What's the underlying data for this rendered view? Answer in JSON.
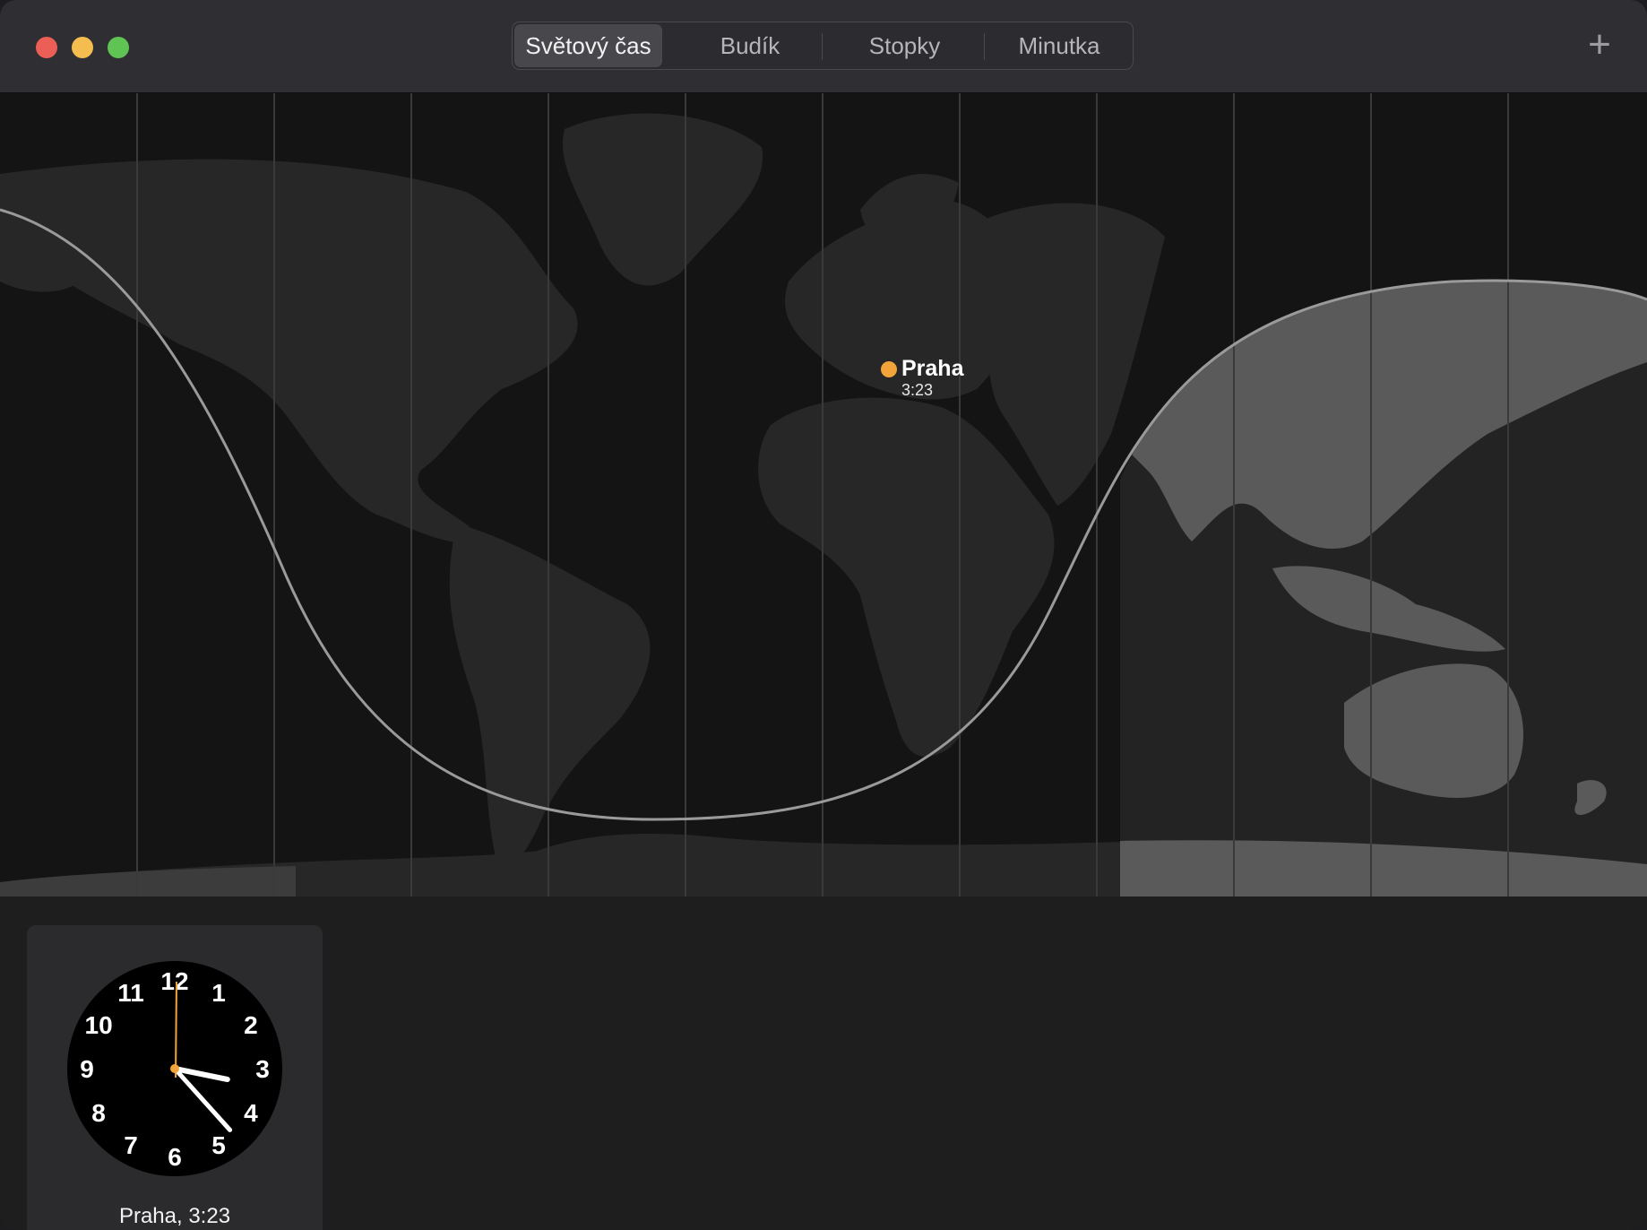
{
  "window": {
    "controls": [
      "close",
      "minimize",
      "zoom"
    ]
  },
  "tabs": [
    {
      "label": "Světový čas",
      "active": true
    },
    {
      "label": "Budík",
      "active": false
    },
    {
      "label": "Stopky",
      "active": false
    },
    {
      "label": "Minutka",
      "active": false
    }
  ],
  "toolbar": {
    "add_label": "+"
  },
  "map": {
    "city": {
      "name": "Praha",
      "time": "3:23",
      "marker_color": "#f2a33a"
    }
  },
  "clocks": [
    {
      "label": "Praha, 3:23",
      "hour": 3,
      "minute": 23,
      "numerals": [
        "12",
        "1",
        "2",
        "3",
        "4",
        "5",
        "6",
        "7",
        "8",
        "9",
        "10",
        "11"
      ]
    }
  ],
  "colors": {
    "accent": "#f2a33a",
    "titlebar": "#2f2e33",
    "traffic_close": "#ec5f56",
    "traffic_min": "#f5bd4f",
    "traffic_max": "#5fc454"
  }
}
